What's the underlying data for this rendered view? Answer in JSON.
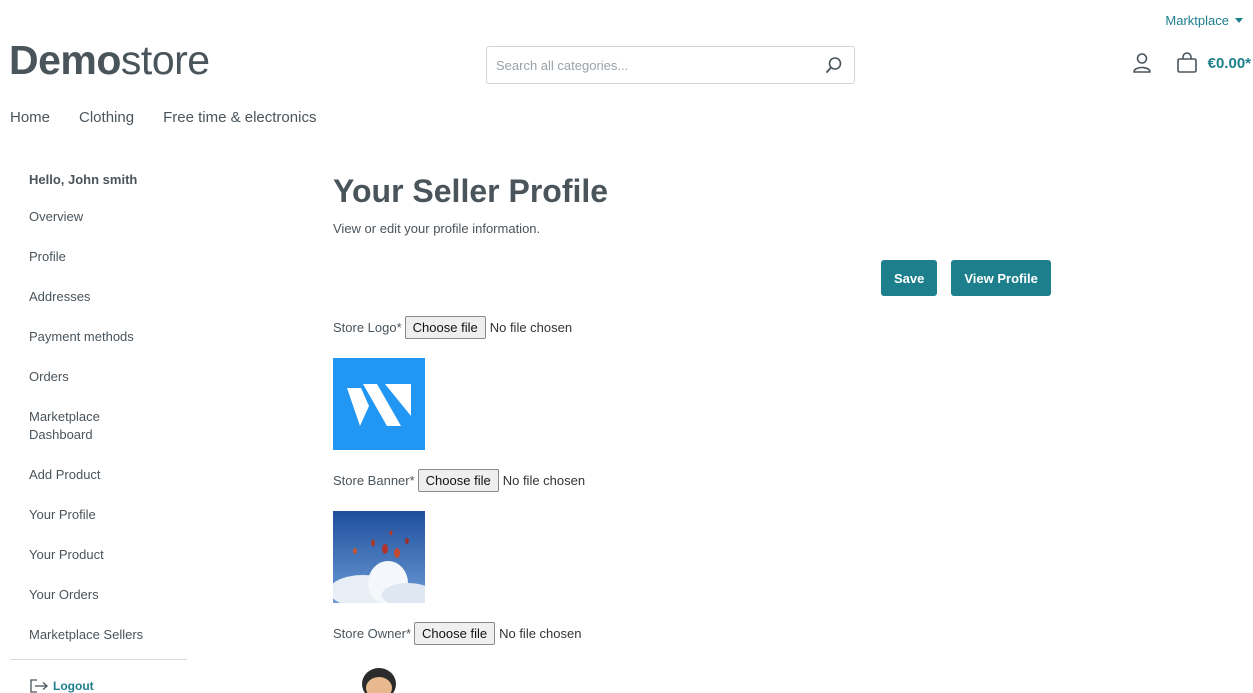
{
  "topbar": {
    "marketplace_label": "Marktplace"
  },
  "logo": {
    "bold": "Demo",
    "light": "store"
  },
  "search": {
    "placeholder": "Search all categories..."
  },
  "header": {
    "cart_total": "€0.00*"
  },
  "nav": [
    {
      "label": "Home"
    },
    {
      "label": "Clothing"
    },
    {
      "label": "Free time & electronics"
    }
  ],
  "sidebar": {
    "greeting": "Hello, John smith",
    "items": [
      {
        "label": "Overview"
      },
      {
        "label": "Profile"
      },
      {
        "label": "Addresses"
      },
      {
        "label": "Payment methods"
      },
      {
        "label": "Orders"
      },
      {
        "label": "Marketplace Dashboard"
      },
      {
        "label": "Add Product"
      },
      {
        "label": "Your Profile"
      },
      {
        "label": "Your Product"
      },
      {
        "label": "Your Orders"
      },
      {
        "label": "Marketplace Sellers"
      }
    ],
    "logout": "Logout"
  },
  "main": {
    "title": "Your Seller Profile",
    "subtitle": "View or edit your profile information.",
    "save_label": "Save",
    "view_profile_label": "View Profile",
    "choose_file_label": "Choose file",
    "no_file_label": "No file chosen",
    "fields": {
      "logo": "Store Logo*",
      "banner": "Store Banner*",
      "owner": "Store Owner*"
    }
  },
  "colors": {
    "accent": "#1d7f8c",
    "text": "#4a545b",
    "logo_blue": "#2196f3"
  },
  "icons": [
    "search-icon",
    "user-icon",
    "cart-icon",
    "logout-icon",
    "caret-down-icon"
  ]
}
